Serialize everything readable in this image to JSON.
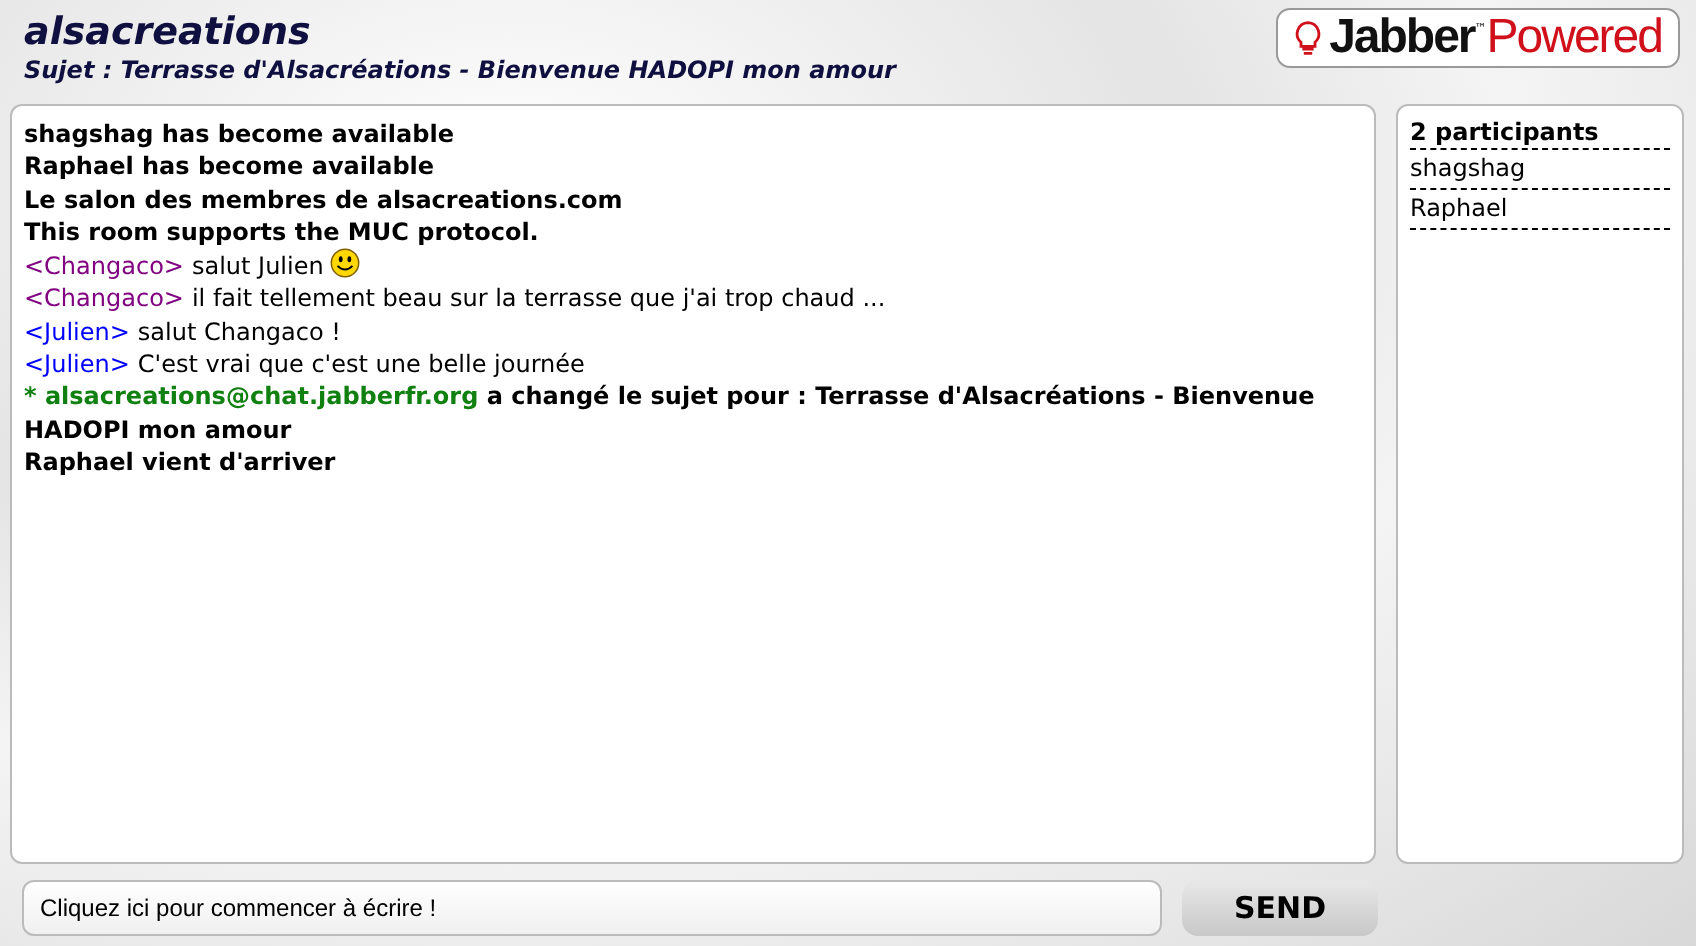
{
  "header": {
    "title": "alsacreations",
    "subject": "Sujet : Terrasse d'Alsacréations - Bienvenue HADOPI mon amour"
  },
  "logo": {
    "brand": "Jabber",
    "tm": "™",
    "suffix": "Powered"
  },
  "messages": [
    {
      "kind": "status",
      "text": "shagshag has become available"
    },
    {
      "kind": "status",
      "text": "Raphael has become available"
    },
    {
      "kind": "status",
      "text": "Le salon des membres de alsacreations.com"
    },
    {
      "kind": "status",
      "text": "This room supports the MUC protocol."
    },
    {
      "kind": "chat",
      "nick": "<Changaco>",
      "color": "#800080",
      "text": "salut Julien",
      "smiley": true
    },
    {
      "kind": "chat",
      "nick": "<Changaco>",
      "color": "#800080",
      "text": "il fait tellement beau sur la terrasse que j'ai trop chaud ...",
      "smiley": false
    },
    {
      "kind": "chat",
      "nick": "<Julien>",
      "color": "#0000ff",
      "text": "salut Changaco !",
      "smiley": false
    },
    {
      "kind": "chat",
      "nick": "<Julien>",
      "color": "#0000ff",
      "text": "C'est vrai que c'est une belle journée",
      "smiley": false
    },
    {
      "kind": "topic",
      "jid": "* alsacreations@chat.jabberfr.org",
      "text": "a changé le sujet pour : Terrasse d'Alsacréations - Bienvenue HADOPI mon amour"
    },
    {
      "kind": "status",
      "text": "Raphael vient d'arriver"
    }
  ],
  "participants": {
    "title": "2 participants",
    "items": [
      "shagshag",
      "Raphael"
    ]
  },
  "composer": {
    "placeholder": "Cliquez ici pour commencer à écrire !",
    "send": "SEND"
  }
}
